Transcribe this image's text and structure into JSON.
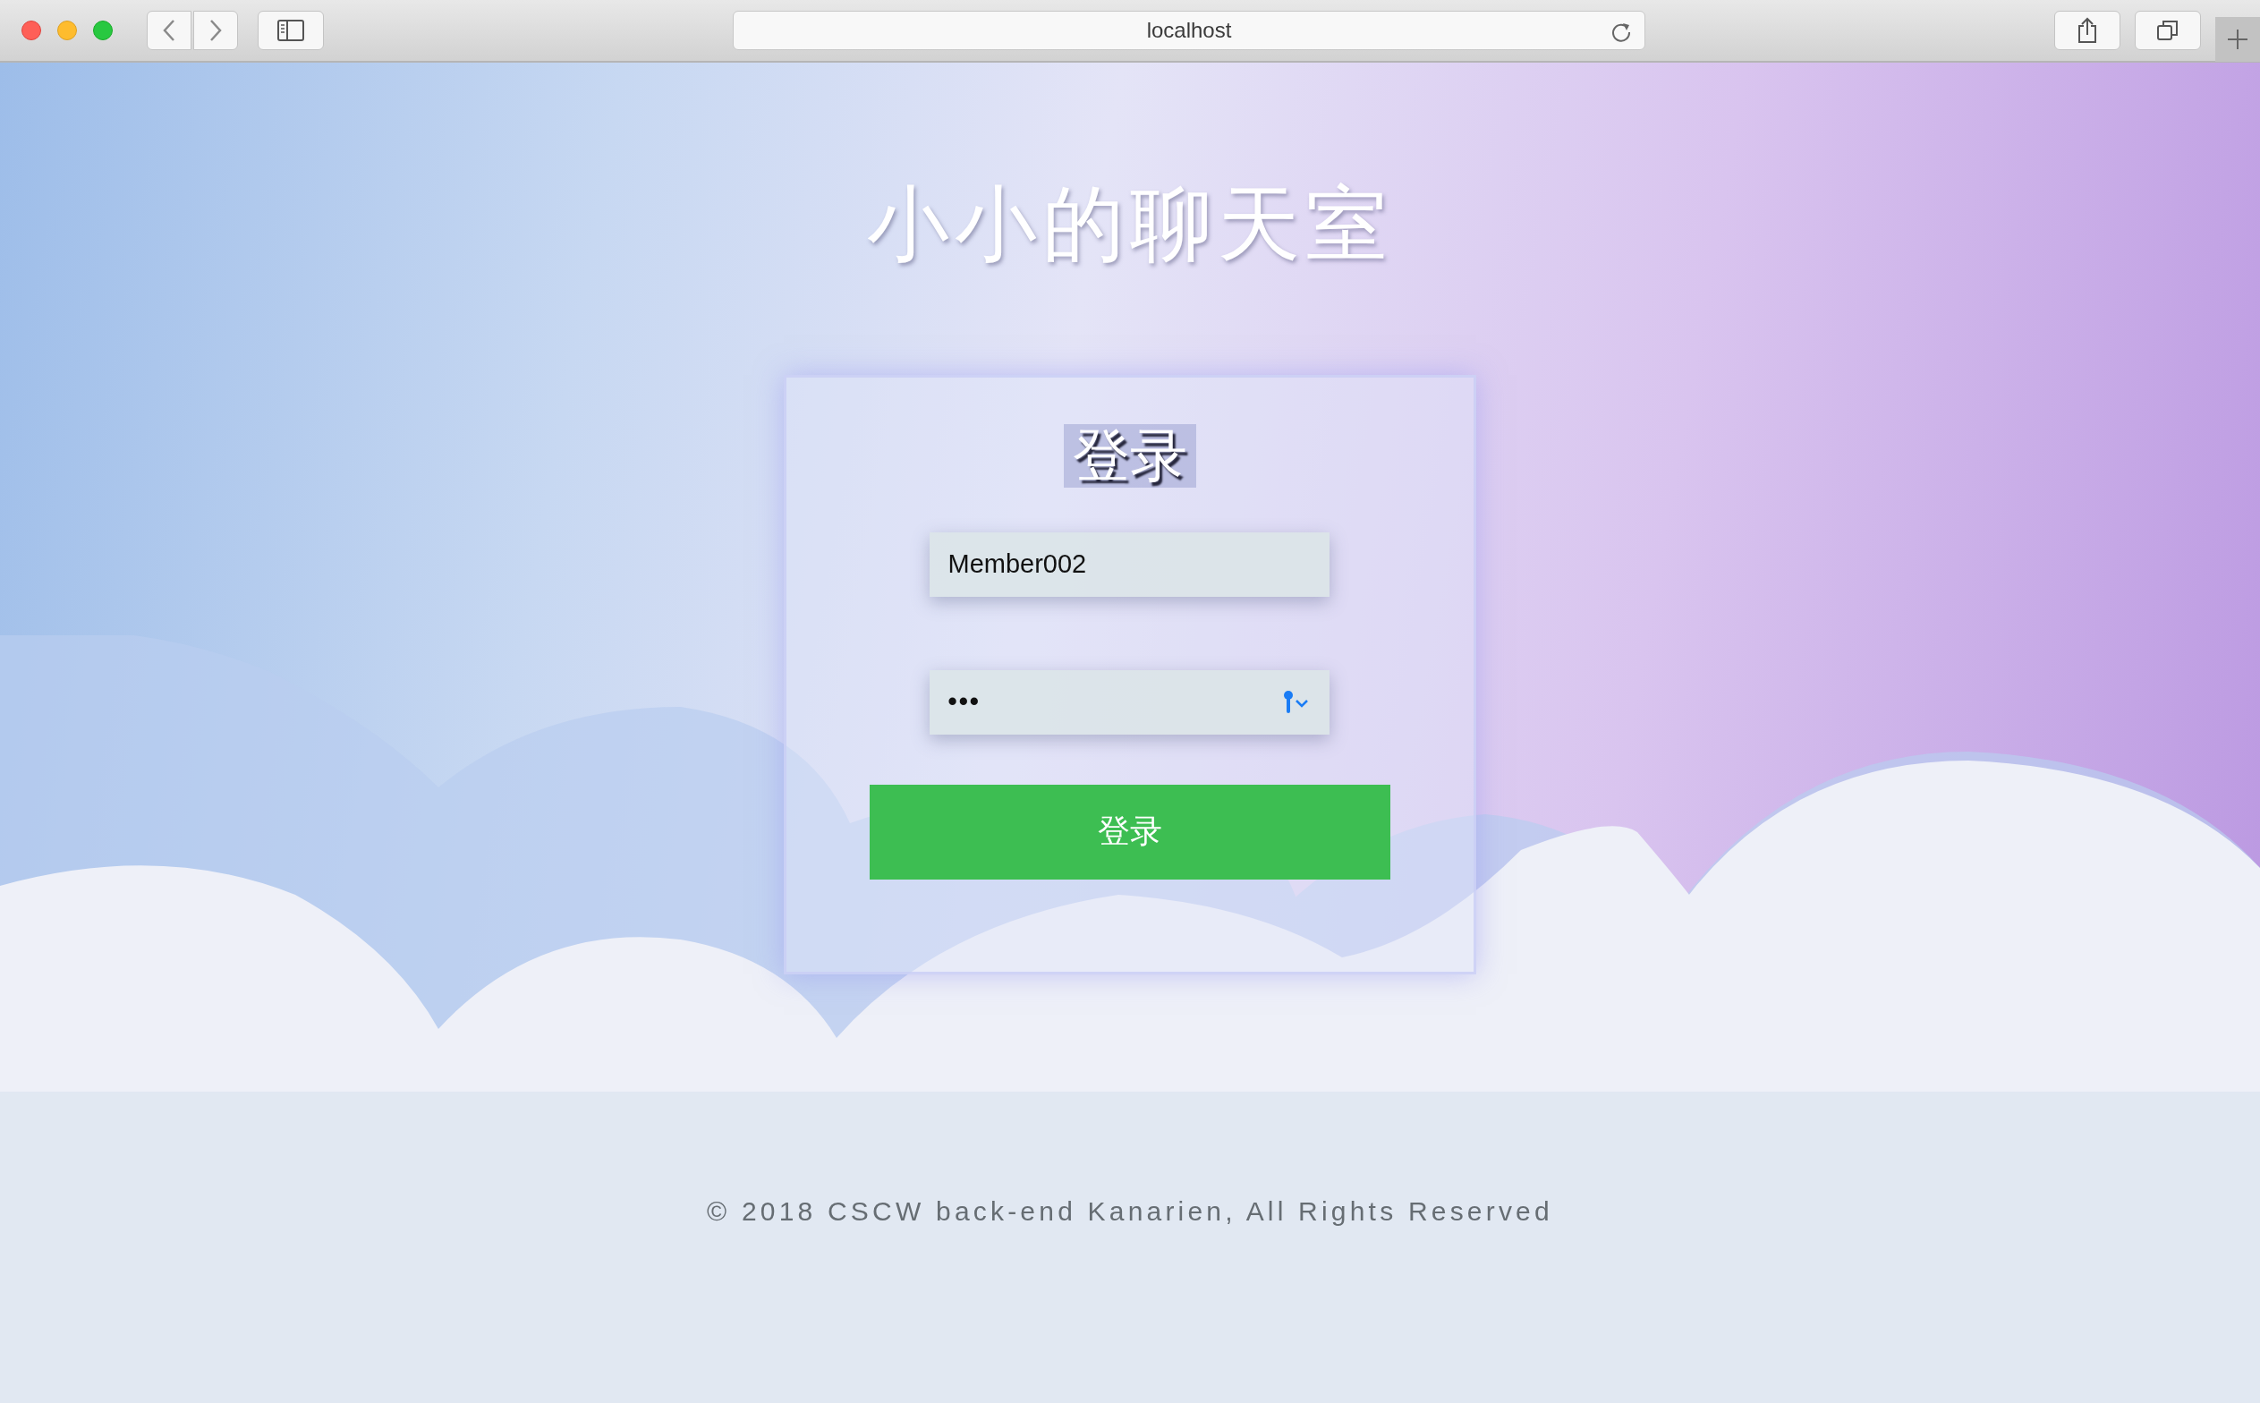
{
  "browser": {
    "address": "localhost"
  },
  "page": {
    "title": "小小的聊天室",
    "login": {
      "heading": "登录",
      "username": {
        "value": "Member002"
      },
      "password": {
        "value": "•••",
        "keychain": true
      },
      "submit": "登录"
    },
    "footer": "© 2018 CSCW back-end Kanarien, All Rights Reserved"
  }
}
